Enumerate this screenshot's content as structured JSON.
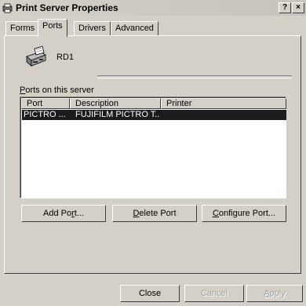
{
  "window": {
    "title": "Print Server Properties",
    "help_label": "?",
    "close_label": "×"
  },
  "tabs": [
    {
      "label": "Forms",
      "active": false
    },
    {
      "label": "Ports",
      "active": true
    },
    {
      "label": "Drivers",
      "active": false
    },
    {
      "label": "Advanced",
      "active": false
    }
  ],
  "server": {
    "name": "RD1",
    "icon": "printer-server-icon"
  },
  "ports": {
    "group_label_prefix": "P",
    "group_label_rest": "orts on this server",
    "columns": [
      "Port",
      "Description",
      "Printer"
    ],
    "rows": [
      {
        "port": "PICTRO ...",
        "description": "FUJIFILM PICTRO T...",
        "printer": "",
        "selected": true
      }
    ]
  },
  "port_buttons": {
    "add_pre": "Add Po",
    "add_key": "r",
    "add_post": "t...",
    "delete_key": "D",
    "delete_post": "elete Port",
    "configure_key": "C",
    "configure_post": "onfigure Port..."
  },
  "dialog_buttons": {
    "close": "Close",
    "cancel": "Cancel",
    "apply_key": "A",
    "apply_post": "pply"
  },
  "colors": {
    "face": "#d4d0c8",
    "selection": "#1c1c1c"
  }
}
